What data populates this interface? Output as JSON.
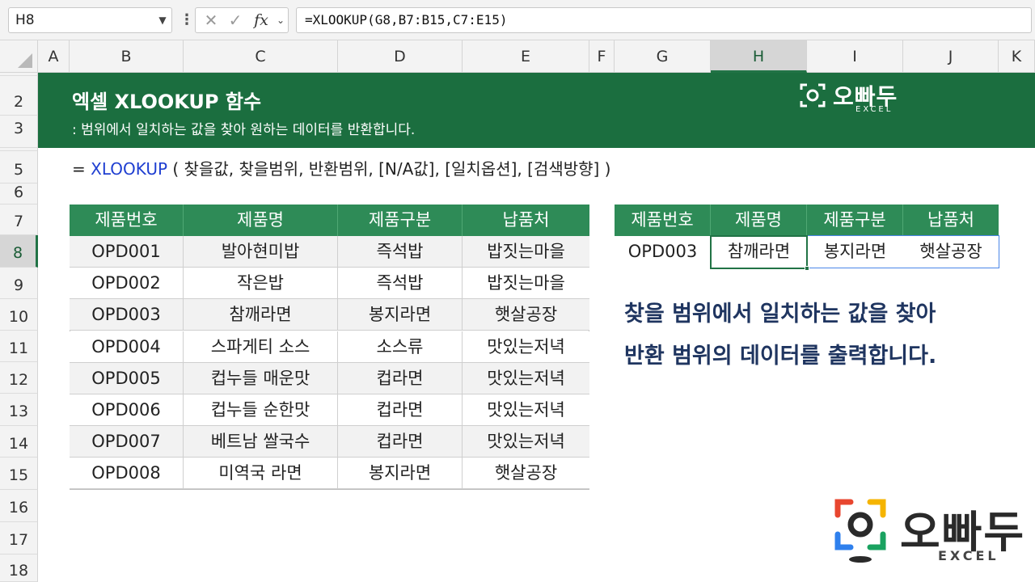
{
  "formula_bar": {
    "name_box": "H8",
    "cancel_icon": "✕",
    "enter_icon": "✓",
    "fx_label": "fx",
    "formula": "=XLOOKUP(G8,B7:B15,C7:E15)"
  },
  "columns": [
    "A",
    "B",
    "C",
    "D",
    "E",
    "F",
    "G",
    "H",
    "I",
    "J",
    "K"
  ],
  "selected_column": "H",
  "rows": [
    "2",
    "3",
    "5",
    "6",
    "7",
    "8",
    "9",
    "10",
    "11",
    "12",
    "13",
    "14",
    "15",
    "16",
    "17",
    "18"
  ],
  "selected_row": "8",
  "banner": {
    "title": "엑셀 XLOOKUP 함수",
    "subtitle": ": 범위에서 일치하는 값을 찾아 원하는 데이터를 반환합니다.",
    "logo_text": "오빠두",
    "logo_sub": "EXCEL"
  },
  "syntax": {
    "prefix": "= ",
    "function": "XLOOKUP",
    "args": " ( 찾을값, 찾을범위, 반환범위, [N/A값], [일치옵션], [검색방향] )"
  },
  "main_table": {
    "headers": [
      "제품번호",
      "제품명",
      "제품구분",
      "납품처"
    ],
    "rows": [
      [
        "OPD001",
        "발아현미밥",
        "즉석밥",
        "밥짓는마을"
      ],
      [
        "OPD002",
        "작은밥",
        "즉석밥",
        "밥짓는마을"
      ],
      [
        "OPD003",
        "참깨라면",
        "봉지라면",
        "햇살공장"
      ],
      [
        "OPD004",
        "스파게티  소스",
        "소스류",
        "맛있는저녁"
      ],
      [
        "OPD005",
        "컵누들 매운맛",
        "컵라면",
        "맛있는저녁"
      ],
      [
        "OPD006",
        "컵누들 순한맛",
        "컵라면",
        "맛있는저녁"
      ],
      [
        "OPD007",
        "베트남 쌀국수",
        "컵라면",
        "맛있는저녁"
      ],
      [
        "OPD008",
        "미역국 라면",
        "봉지라면",
        "햇살공장"
      ]
    ]
  },
  "result_table": {
    "headers": [
      "제품번호",
      "제품명",
      "제품구분",
      "납품처"
    ],
    "row": [
      "OPD003",
      "참깨라면",
      "봉지라면",
      "햇살공장"
    ]
  },
  "explanation": {
    "line1": "찾을 범위에서 일치하는 값을 찾아",
    "line2": "반환 범위의 데이터를 출력합니다."
  },
  "footer_logo": {
    "text": "오빠두",
    "sub": "EXCEL"
  },
  "colors": {
    "banner": "#1b6e3f",
    "table_header": "#2e8b57",
    "selection": "#217346",
    "function_name": "#1f3fd1",
    "explanation_text": "#1f3560"
  }
}
